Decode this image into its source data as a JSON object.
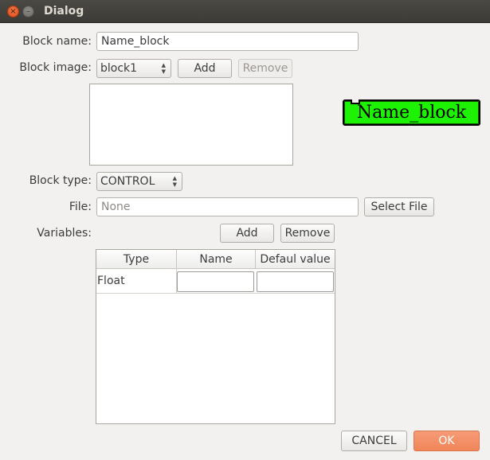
{
  "window": {
    "title": "Dialog",
    "close_glyph": "×",
    "minimize_glyph": "–"
  },
  "form": {
    "block_name_label": "Block name:",
    "block_name_value": "Name_block",
    "block_image_label": "Block image:",
    "block_image_value": "block1",
    "image_add_label": "Add",
    "image_remove_label": "Remove",
    "block_type_label": "Block type:",
    "block_type_value": "CONTROL",
    "file_label": "File:",
    "file_placeholder": "None",
    "select_file_label": "Select File",
    "variables_label": "Variables:",
    "var_add_label": "Add",
    "var_remove_label": "Remove"
  },
  "preview": {
    "block_text": "Name_block",
    "block_color": "#1df204"
  },
  "variables_table": {
    "headers": [
      "Type",
      "Name",
      "Defaul value"
    ],
    "rows": [
      {
        "type": "Float",
        "name": "",
        "default": ""
      }
    ]
  },
  "footer": {
    "cancel_label": "CANCEL",
    "ok_label": "OK"
  },
  "colors": {
    "accent": "#f18658",
    "titlebar": "#3c3b37",
    "close": "#df4b16"
  }
}
